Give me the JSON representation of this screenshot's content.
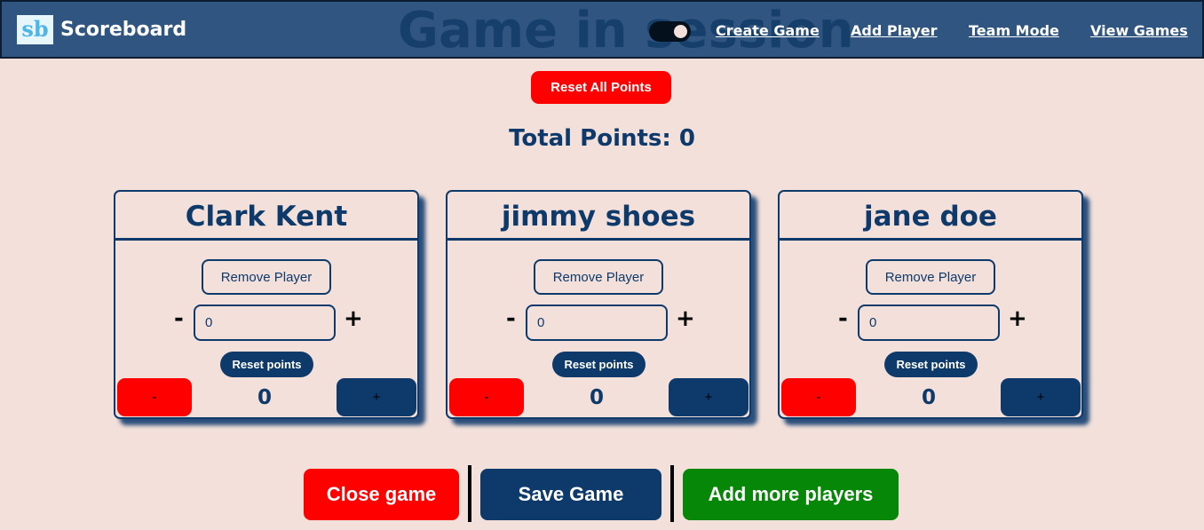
{
  "header": {
    "logo_mark": "sb",
    "app_name": "Scoreboard",
    "page_title": "Game in session",
    "nav": [
      "Create Game",
      "Add Player",
      "Team Mode",
      "View Games"
    ]
  },
  "controls": {
    "reset_all_label": "Reset All Points",
    "total_points_label": "Total Points: 0"
  },
  "players": [
    {
      "name": "Clark Kent",
      "remove_label": "Remove Player",
      "minus": "-",
      "plus": "+",
      "input_value": "0",
      "reset_label": "Reset points",
      "dec_label": "-",
      "inc_label": "+",
      "score": "0"
    },
    {
      "name": "jimmy shoes",
      "remove_label": "Remove Player",
      "minus": "-",
      "plus": "+",
      "input_value": "0",
      "reset_label": "Reset points",
      "dec_label": "-",
      "inc_label": "+",
      "score": "0"
    },
    {
      "name": "jane doe",
      "remove_label": "Remove Player",
      "minus": "-",
      "plus": "+",
      "input_value": "0",
      "reset_label": "Reset points",
      "dec_label": "-",
      "inc_label": "+",
      "score": "0"
    }
  ],
  "footer": {
    "close_label": "Close game",
    "save_label": "Save Game",
    "add_label": "Add more players"
  },
  "colors": {
    "navbar": "#2f5580",
    "background": "#f3e0da",
    "primary": "#0e3a6b",
    "danger": "#ff0000",
    "success": "#078707"
  }
}
